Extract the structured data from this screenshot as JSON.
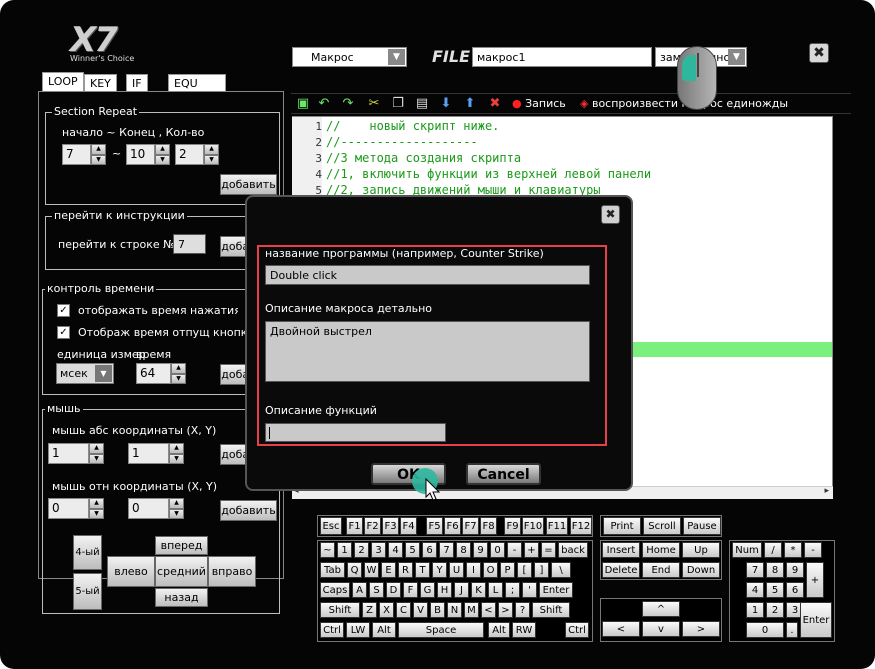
{
  "app": {
    "logo": "X7",
    "tagline": "Winner's Choice"
  },
  "tabs": [
    "LOOP",
    "KEY",
    "IF",
    "EQU"
  ],
  "section_repeat": {
    "title": "Section Repeat",
    "caption": "начало ~ Конец , Кол-во",
    "start": "7",
    "tilde": "~",
    "end": "10",
    "count": "2",
    "add": "добавить"
  },
  "goto": {
    "title": "перейти к инструкции",
    "label": "перейти к строке №:",
    "value": "7",
    "add": "добавить"
  },
  "time": {
    "title": "контроль времени",
    "show_press": "отображать время нажатия кнопки",
    "show_release": "Отображ время отпущ кнопки",
    "unit_label": "единица измер",
    "time_label": "время",
    "unit": "мсек",
    "value": "64",
    "add": "добавить",
    "check": "✓"
  },
  "mouse": {
    "title": "мышь",
    "abs_label": "мышь абс координаты (X, Y)",
    "abs_x": "1",
    "abs_y": "1",
    "rel_label": "мышь отн координаты (X, Y)",
    "rel_x": "0",
    "rel_y": "0",
    "add": "добавить",
    "b4": "4-ый",
    "b5": "5-ый",
    "up": "вперед",
    "left": "влево",
    "center": "средний",
    "right": "вправо",
    "down": "назад"
  },
  "header": {
    "macro_type": "Макрос",
    "file_label": "FILE",
    "file_name": "макрос1",
    "mode": "замедленно"
  },
  "toolbar": {
    "record": "Запись",
    "playback": "воспроизвести макрос единожды"
  },
  "editor": {
    "line_numbers": [
      "1",
      "2",
      "3",
      "4",
      "5"
    ],
    "lines": [
      "//    новый скрипт ниже.",
      "//-------------------",
      "//3 метода создания скрипта",
      "//1, включить функции из верхней левой панели",
      "//2, запись движений мыши и клавиатуры"
    ]
  },
  "dialog": {
    "name_label": "название программы (например, Counter Strike)",
    "name_value": "Double click",
    "desc_label": "Описание макроса детально",
    "desc_value": "Двойной выстрел",
    "func_label": "Описание функций",
    "func_value": "",
    "ok": "OK",
    "cancel": "Cancel"
  },
  "keyboard": {
    "fn_row": [
      "Esc",
      "F1",
      "F2",
      "F3",
      "F4",
      "F5",
      "F6",
      "F7",
      "F8",
      "F9",
      "F10",
      "F11",
      "F12"
    ],
    "nav_top": [
      "Print",
      "Scroll",
      "Pause"
    ],
    "row1": [
      "~",
      "1",
      "2",
      "3",
      "4",
      "5",
      "6",
      "7",
      "8",
      "9",
      "0",
      "-",
      "+",
      "=",
      "back"
    ],
    "row2": [
      "Tab",
      "Q",
      "W",
      "E",
      "R",
      "T",
      "Y",
      "U",
      "I",
      "O",
      "P",
      "[",
      "]",
      "\\"
    ],
    "row3": [
      "Caps",
      "A",
      "S",
      "D",
      "F",
      "G",
      "H",
      "J",
      "K",
      "L",
      ";",
      "'",
      "Enter"
    ],
    "row4": [
      "Shift",
      "Z",
      "X",
      "C",
      "V",
      "B",
      "N",
      "M",
      "<",
      ">",
      "?",
      "Shift"
    ],
    "row5": [
      "Ctrl",
      "LW",
      "Alt",
      "Space",
      "Alt",
      "RW",
      "Ctrl"
    ],
    "nav": [
      "Insert",
      "Home",
      "Up",
      "Delete",
      "End",
      "Down"
    ],
    "arrows": [
      "^",
      "<",
      "v",
      ">"
    ],
    "numpad": [
      "Num",
      "/",
      "*",
      "-",
      "7",
      "8",
      "9",
      "+",
      "4",
      "5",
      "6",
      "1",
      "2",
      "3",
      "Enter",
      "0",
      "."
    ]
  },
  "colors": {
    "highlight": "#e8404a",
    "code_green": "#1a9a1a",
    "dialog_bg": "#0a0a0a",
    "green_bar": "#7cf07c"
  }
}
